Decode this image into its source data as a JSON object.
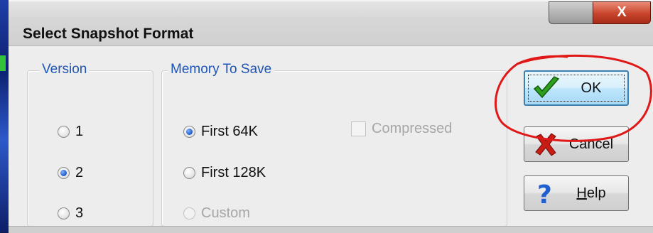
{
  "window": {
    "title": "Select Snapshot Format",
    "close_glyph": "X"
  },
  "version_group": {
    "label": "Version",
    "options": [
      {
        "label": "1",
        "checked": false
      },
      {
        "label": "2",
        "checked": true
      },
      {
        "label": "3",
        "checked": false
      }
    ]
  },
  "memory_group": {
    "label": "Memory To Save",
    "options": [
      {
        "label": "First 64K",
        "checked": true,
        "enabled": true
      },
      {
        "label": "First 128K",
        "checked": false,
        "enabled": true
      },
      {
        "label": "Custom",
        "checked": false,
        "enabled": false
      }
    ],
    "compressed": {
      "label": "Compressed",
      "checked": false,
      "enabled": false
    }
  },
  "buttons": {
    "ok": {
      "label": "OK",
      "icon": "checkmark-icon"
    },
    "cancel": {
      "label": "Cancel",
      "icon": "red-x-icon"
    },
    "help": {
      "label_accel": "H",
      "label_rest": "elp",
      "icon": "question-mark-icon"
    }
  },
  "colors": {
    "group_label": "#1d55b6",
    "annotation": "#e01818",
    "close_button": "#c8442c"
  }
}
